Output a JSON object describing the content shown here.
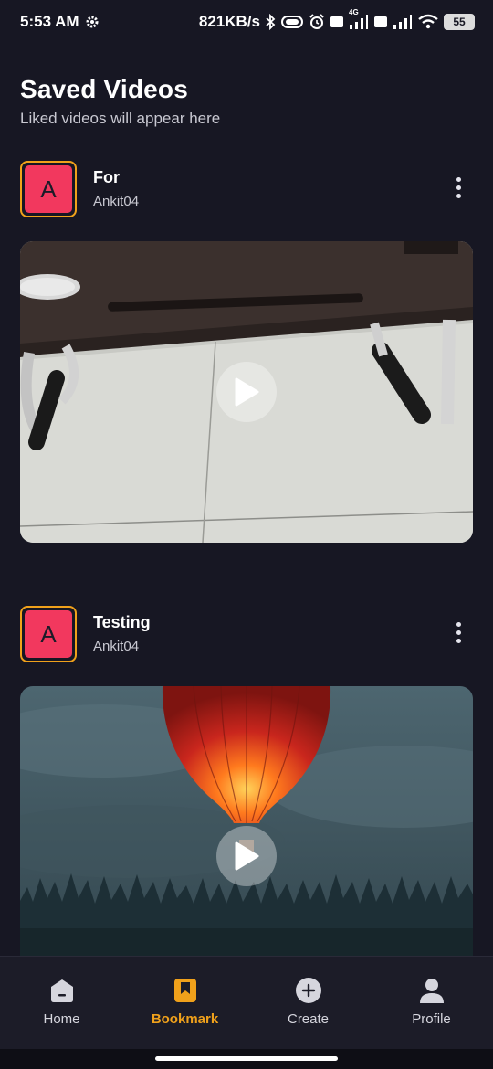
{
  "status_bar": {
    "time": "5:53 AM",
    "net_speed": "821KB/s",
    "battery": "55",
    "network_badge": "4G",
    "icons": [
      "gear-icon",
      "bluetooth-icon",
      "vibrate-icon",
      "alarm-icon",
      "volte-icon",
      "signal-icon",
      "wifi-icon",
      "battery-icon"
    ]
  },
  "header": {
    "title": "Saved Videos",
    "subtitle": "Liked videos will appear here"
  },
  "videos": [
    {
      "avatar_letter": "A",
      "title": "For",
      "user": "Ankit04"
    },
    {
      "avatar_letter": "A",
      "title": "Testing",
      "user": "Ankit04"
    }
  ],
  "nav": {
    "items": [
      {
        "label": "Home",
        "icon": "home-icon"
      },
      {
        "label": "Bookmark",
        "icon": "bookmark-icon"
      },
      {
        "label": "Create",
        "icon": "plus-circle-icon"
      },
      {
        "label": "Profile",
        "icon": "person-icon"
      }
    ],
    "active": "Bookmark"
  },
  "colors": {
    "background": "#171723",
    "accent": "#f0a11b",
    "avatar": "#f2385e",
    "nav_background": "#1c1c28"
  }
}
